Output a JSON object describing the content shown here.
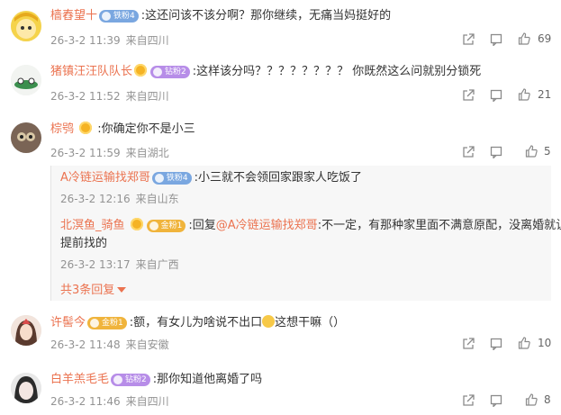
{
  "comments": [
    {
      "user": "樯舂望十",
      "badge": "铁粉4",
      "text": ":这还问该不该分啊？那你继续，无痛当妈挺好的",
      "date": "26-3-2 11:39",
      "location": "来自四川",
      "likes": "69"
    },
    {
      "user": "猪镇汪汪队队长",
      "badge": "钻粉2",
      "text": ":这样该分吗？？？？？？？？ 你既然这么问就别分锁死",
      "date": "26-3-2 11:52",
      "location": "来自四川",
      "likes": "21"
    },
    {
      "user": "棕鸮",
      "text": ":你确定你不是小三",
      "date": "26-3-2 11:59",
      "location": "来自湖北",
      "likes": "5"
    },
    {
      "user": "许髻今",
      "badge": "金粉1",
      "text": ":额，有女儿为啥说不出口",
      "text2": "这想干嘛（）",
      "date": "26-3-2 11:48",
      "location": "来自安徽",
      "likes": "10"
    },
    {
      "user": "白羊羔毛毛",
      "badge": "钻粉2",
      "text": ":那你知道他离婚了吗",
      "date": "26-3-2 11:46",
      "location": "来自四川",
      "likes": "8"
    }
  ],
  "replies": [
    {
      "user": "A冷链运输找郑哥",
      "badge": "铁粉4",
      "text": ":小三就不会领回家跟家人吃饭了",
      "date": "26-3-2 12:16",
      "location": "来自山东"
    },
    {
      "user": "北溟鱼_骑鱼",
      "badge": "金粉1",
      "prefix": ":回复",
      "mention": "@A冷链运输找郑哥",
      "text": ":不一定，有那种家里面不满意原配，没离婚就让",
      "text_cont": "提前找的",
      "date": "26-3-2 13:17",
      "location": "来自广西"
    }
  ],
  "more_replies": "共3条回复",
  "icons": {
    "share": "share-icon",
    "comment": "comment-icon",
    "like": "thumb-up-icon"
  },
  "colors": {
    "username": "#eb7350",
    "meta": "#939393"
  }
}
